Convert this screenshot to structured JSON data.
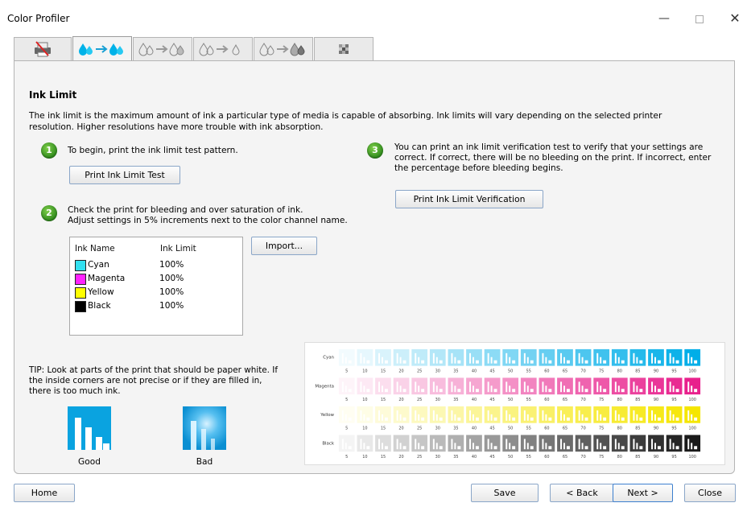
{
  "window": {
    "title": "Color Profiler",
    "controls": {
      "minimize": "—",
      "close": "✕"
    }
  },
  "tabs": [
    {
      "icon": "printer-icon",
      "active": false
    },
    {
      "icon": "ink-limit-icon",
      "active": true
    },
    {
      "icon": "linearization-icon",
      "active": false
    },
    {
      "icon": "total-ink-icon",
      "active": false
    },
    {
      "icon": "profile-icon",
      "active": false
    },
    {
      "icon": "color-chart-icon",
      "active": false
    }
  ],
  "page": {
    "title": "Ink Limit",
    "description": "The ink limit is the maximum amount of ink a particular type of media is capable of absorbing. Ink limits will vary depending on the selected printer resolution. Higher resolutions have more trouble with ink absorption."
  },
  "steps": {
    "step1": {
      "num": "1",
      "text": "To begin, print the ink limit test pattern.",
      "button": "Print Ink Limit Test"
    },
    "step2": {
      "num": "2",
      "line1": "Check the print for bleeding and over saturation of ink.",
      "line2": "Adjust settings in 5% increments next to the color channel name."
    },
    "step3": {
      "num": "3",
      "text": "You can print an ink limit verification test to verify that your settings are correct. If correct, there will be no bleeding on the print. If incorrect, enter the percentage before bleeding begins.",
      "button": "Print Ink Limit Verification"
    }
  },
  "ink_table": {
    "headers": {
      "name": "Ink Name",
      "limit": "Ink Limit"
    },
    "rows": [
      {
        "name": "Cyan",
        "limit": "100%",
        "color": "#33e0f0"
      },
      {
        "name": "Magenta",
        "limit": "100%",
        "color": "#ff22ff"
      },
      {
        "name": "Yellow",
        "limit": "100%",
        "color": "#ffff00"
      },
      {
        "name": "Black",
        "limit": "100%",
        "color": "#000000"
      }
    ],
    "import_button": "Import..."
  },
  "tip": {
    "text": "TIP: Look at parts of the print that should be paper white. If the inside corners are not precise or if they are filled in, there is too much ink.",
    "good_label": "Good",
    "bad_label": "Bad"
  },
  "pattern": {
    "channels": [
      {
        "name": "Cyan",
        "color": "#00aee8"
      },
      {
        "name": "Magenta",
        "color": "#e8208c"
      },
      {
        "name": "Yellow",
        "color": "#f5e600"
      },
      {
        "name": "Black",
        "color": "#1a1a1a"
      }
    ],
    "percents": [
      "5",
      "10",
      "15",
      "20",
      "25",
      "30",
      "35",
      "40",
      "45",
      "50",
      "55",
      "60",
      "65",
      "70",
      "75",
      "80",
      "85",
      "90",
      "95",
      "100"
    ]
  },
  "footer": {
    "home": "Home",
    "save": "Save",
    "back": "< Back",
    "next": "Next >",
    "close": "Close"
  }
}
